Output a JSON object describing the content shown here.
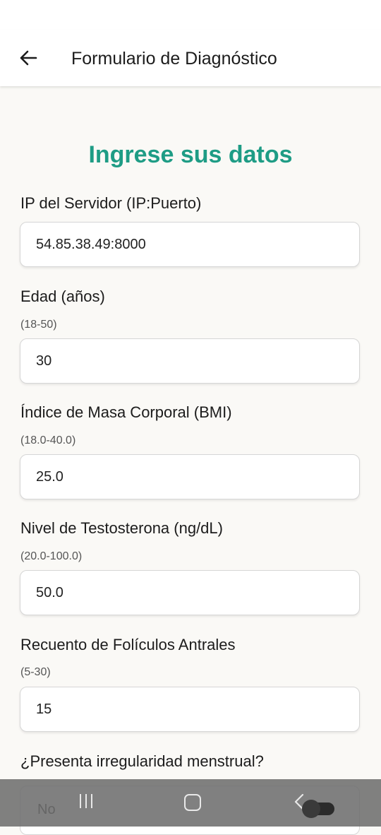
{
  "app_bar": {
    "title": "Formulario de Diagnóstico",
    "back_icon": "arrow-left-icon"
  },
  "form": {
    "heading": "Ingrese sus datos",
    "accent_color": "#1e9c85",
    "fields": [
      {
        "label": "IP del Servidor (IP:Puerto)",
        "hint": "",
        "value": "54.85.38.49:8000"
      },
      {
        "label": "Edad (años)",
        "hint": "(18-50)",
        "value": "30"
      },
      {
        "label": "Índice de Masa Corporal (BMI)",
        "hint": "(18.0-40.0)",
        "value": "25.0"
      },
      {
        "label": "Nivel de Testosterona (ng/dL)",
        "hint": "(20.0-100.0)",
        "value": "50.0"
      },
      {
        "label": "Recuento de Folículos Antrales",
        "hint": "(5-30)",
        "value": "15"
      }
    ],
    "menstrual_question": "¿Presenta irregularidad menstrual?",
    "menstrual_value": "No"
  },
  "nav_bar": {
    "icons": [
      "recents-icon",
      "home-icon",
      "back-icon"
    ]
  }
}
